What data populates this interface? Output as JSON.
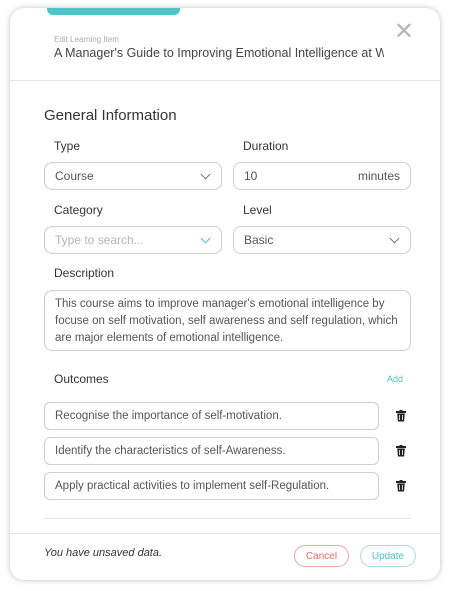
{
  "header": {
    "caption": "Edit Learning Item",
    "title": "A Manager's Guide to Improving Emotional Intelligence at Worl",
    "close_symbol": "✕"
  },
  "section": {
    "title": "General Information"
  },
  "fields": {
    "type": {
      "label": "Type",
      "value": "Course"
    },
    "duration": {
      "label": "Duration",
      "value": "10",
      "unit": "minutes"
    },
    "category": {
      "label": "Category",
      "placeholder": "Type to search..."
    },
    "level": {
      "label": "Level",
      "value": "Basic"
    },
    "description": {
      "label": "Description",
      "value": "This course aims to improve manager's emotional intelligence by focuse on self motivation, self awareness and self regulation, which are major elements of emotional intelligence."
    }
  },
  "outcomes": {
    "label": "Outcomes",
    "add_label": "Add",
    "items": [
      "Recognise the importance of self-motivation.",
      "Identify the characteristics of self-Awareness.",
      "Apply practical activities to implement self-Regulation."
    ]
  },
  "footer": {
    "unsaved_text": "You have unsaved data.",
    "cancel_label": "Cancel",
    "update_label": "Update"
  },
  "colors": {
    "accent": "#4fc3c7",
    "cancel": "#e46b60"
  },
  "icons": {
    "close": "close-icon",
    "chevron": "chevron-down-icon",
    "trash": "trash-icon"
  }
}
